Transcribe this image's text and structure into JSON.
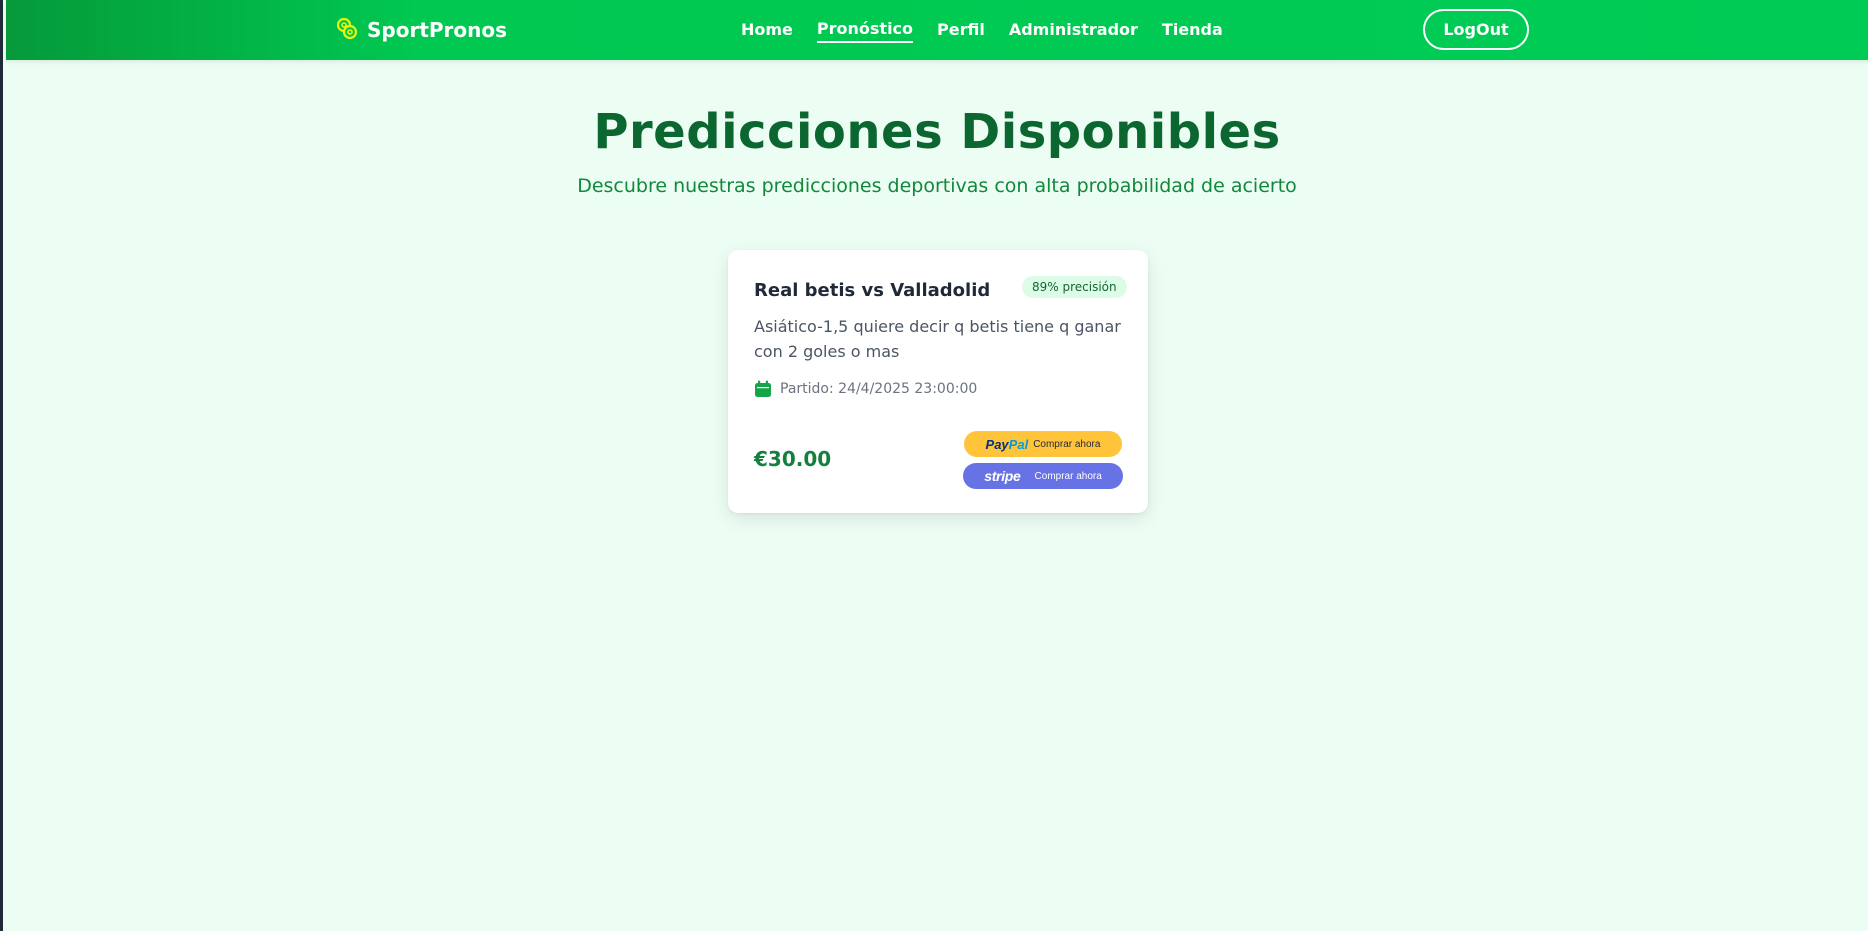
{
  "nav": {
    "brand": "SportPronos",
    "links": [
      {
        "label": "Home"
      },
      {
        "label": "Pronóstico"
      },
      {
        "label": "Perfil"
      },
      {
        "label": "Administrador"
      },
      {
        "label": "Tienda"
      }
    ],
    "active_link": "Pronóstico",
    "logout_label": "LogOut"
  },
  "header": {
    "title": "Predicciones Disponibles",
    "subtitle": "Descubre nuestras predicciones deportivas con alta probabilidad de acierto"
  },
  "predictions": [
    {
      "title": "Real betis vs Valladolid",
      "badge": "89% precisión",
      "description": "Asiático-1,5 quiere decir q betis tiene q ganar con 2 goles o mas",
      "date_label": "Partido: 24/4/2025 23:00:00",
      "price": "€30.00",
      "paypal": {
        "logo_pay": "Pay",
        "logo_pal": "Pal",
        "label": "Comprar ahora"
      },
      "stripe": {
        "logo": "stripe",
        "label": "Comprar ahora"
      }
    }
  ],
  "colors": {
    "nav_bg": "#00cc55",
    "title": "#0b6630",
    "subtitle": "#11883c",
    "page_bg": "#ecfdf3",
    "price": "#15803d",
    "paypal": "#ffc439",
    "stripe": "#6772e5"
  },
  "icons": {
    "brand": "coins-icon",
    "date": "calendar-icon"
  }
}
